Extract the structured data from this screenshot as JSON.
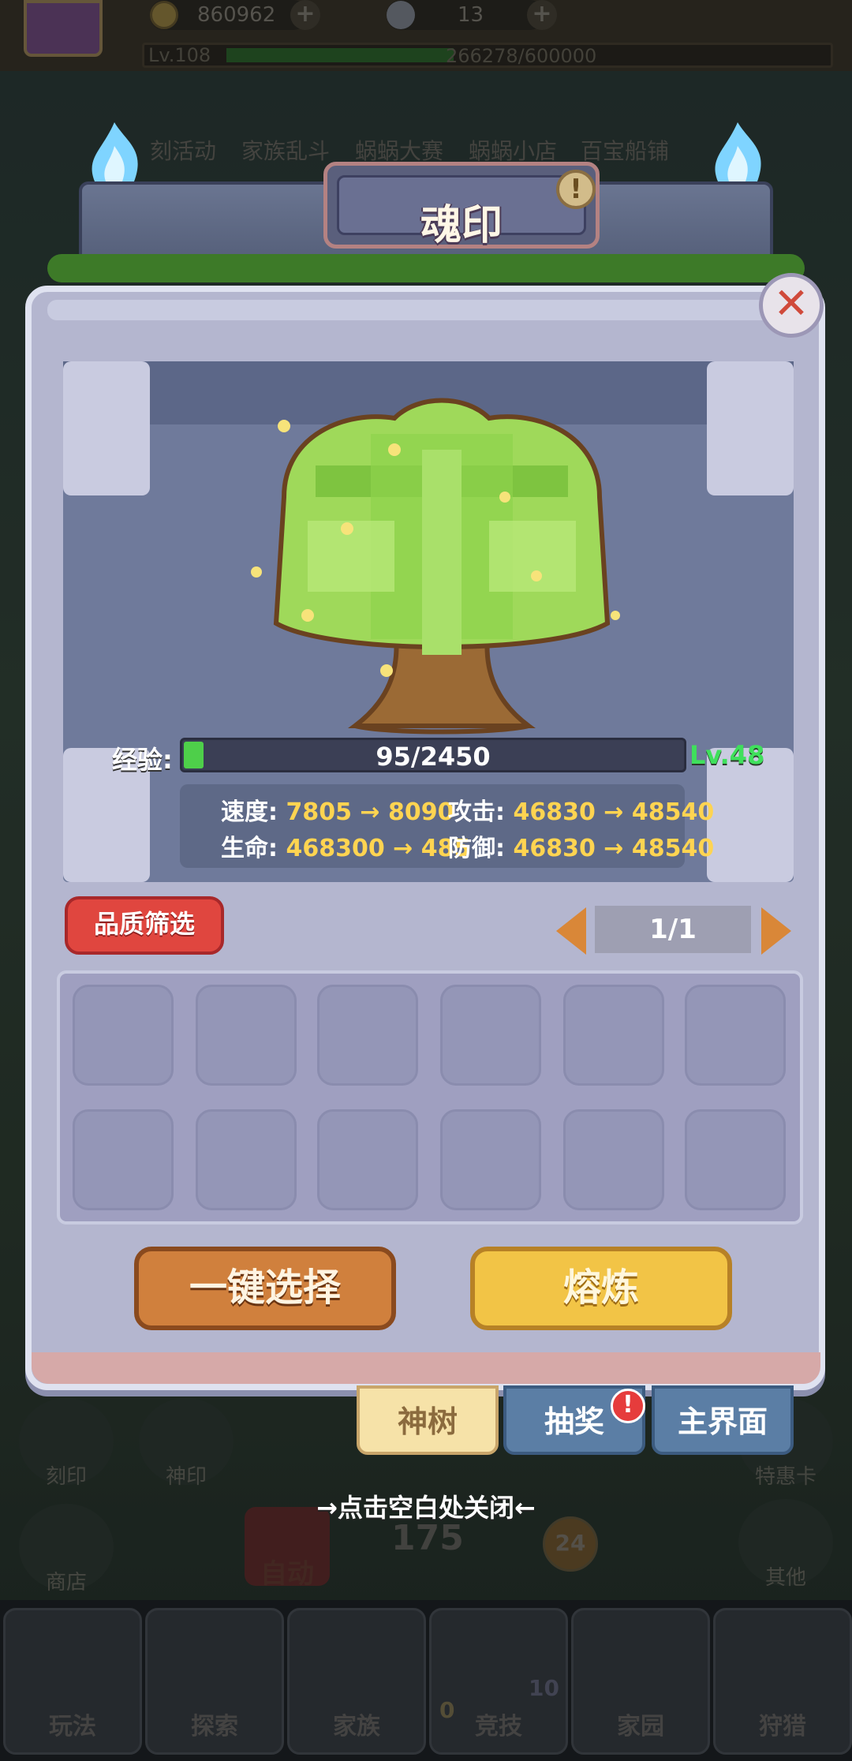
{
  "hud": {
    "coins": "860962",
    "shells": "13",
    "level": "Lv.108",
    "level_progress": "266278/600000",
    "level_progress_value": 0.4438
  },
  "top_nav": [
    "刻活动",
    "家族乱斗",
    "蜗蜗大赛",
    "蜗蜗小店",
    "百宝船铺"
  ],
  "dialog": {
    "title": "魂印",
    "info_icon": "exclamation-icon",
    "close_icon": "close-x-icon"
  },
  "tree": {
    "exp_label": "经验:",
    "exp_text": "95/2450",
    "exp_value": 0.0388,
    "level": "Lv.48",
    "stats": {
      "speed": {
        "label": "速度:",
        "value": "7805 → 8090"
      },
      "attack": {
        "label": "攻击:",
        "value": "46830 → 48540"
      },
      "hp": {
        "label": "生命:",
        "value": "468300 → 485"
      },
      "defense": {
        "label": "防御:",
        "value": "46830 → 48540"
      }
    }
  },
  "filter_button": "品质筛选",
  "pager": {
    "text": "1/1"
  },
  "actions": {
    "select_all": "一键选择",
    "smelt": "熔炼"
  },
  "tabs": {
    "tree": "神树",
    "lottery": "抽奖",
    "main": "主界面",
    "lottery_badge": "!"
  },
  "close_hint": "→点击空白处关闭←",
  "background": {
    "side_left": [
      "刻印",
      "神印",
      "商店"
    ],
    "side_right": [
      "特惠卡",
      "其他"
    ],
    "auto": "自动",
    "counter": "175",
    "counter_badge": "24",
    "bottom_nav": [
      "玩法",
      "探索",
      "家族",
      "竞技",
      "家园",
      "狩猎"
    ],
    "arena_left": "0",
    "arena_right": "10"
  },
  "colors": {
    "panel": "#b4b6cf",
    "stat_value": "#ffd451",
    "level_green": "#3fe05c",
    "filter_red": "#e0463f",
    "smelt_yellow": "#f2c446"
  }
}
